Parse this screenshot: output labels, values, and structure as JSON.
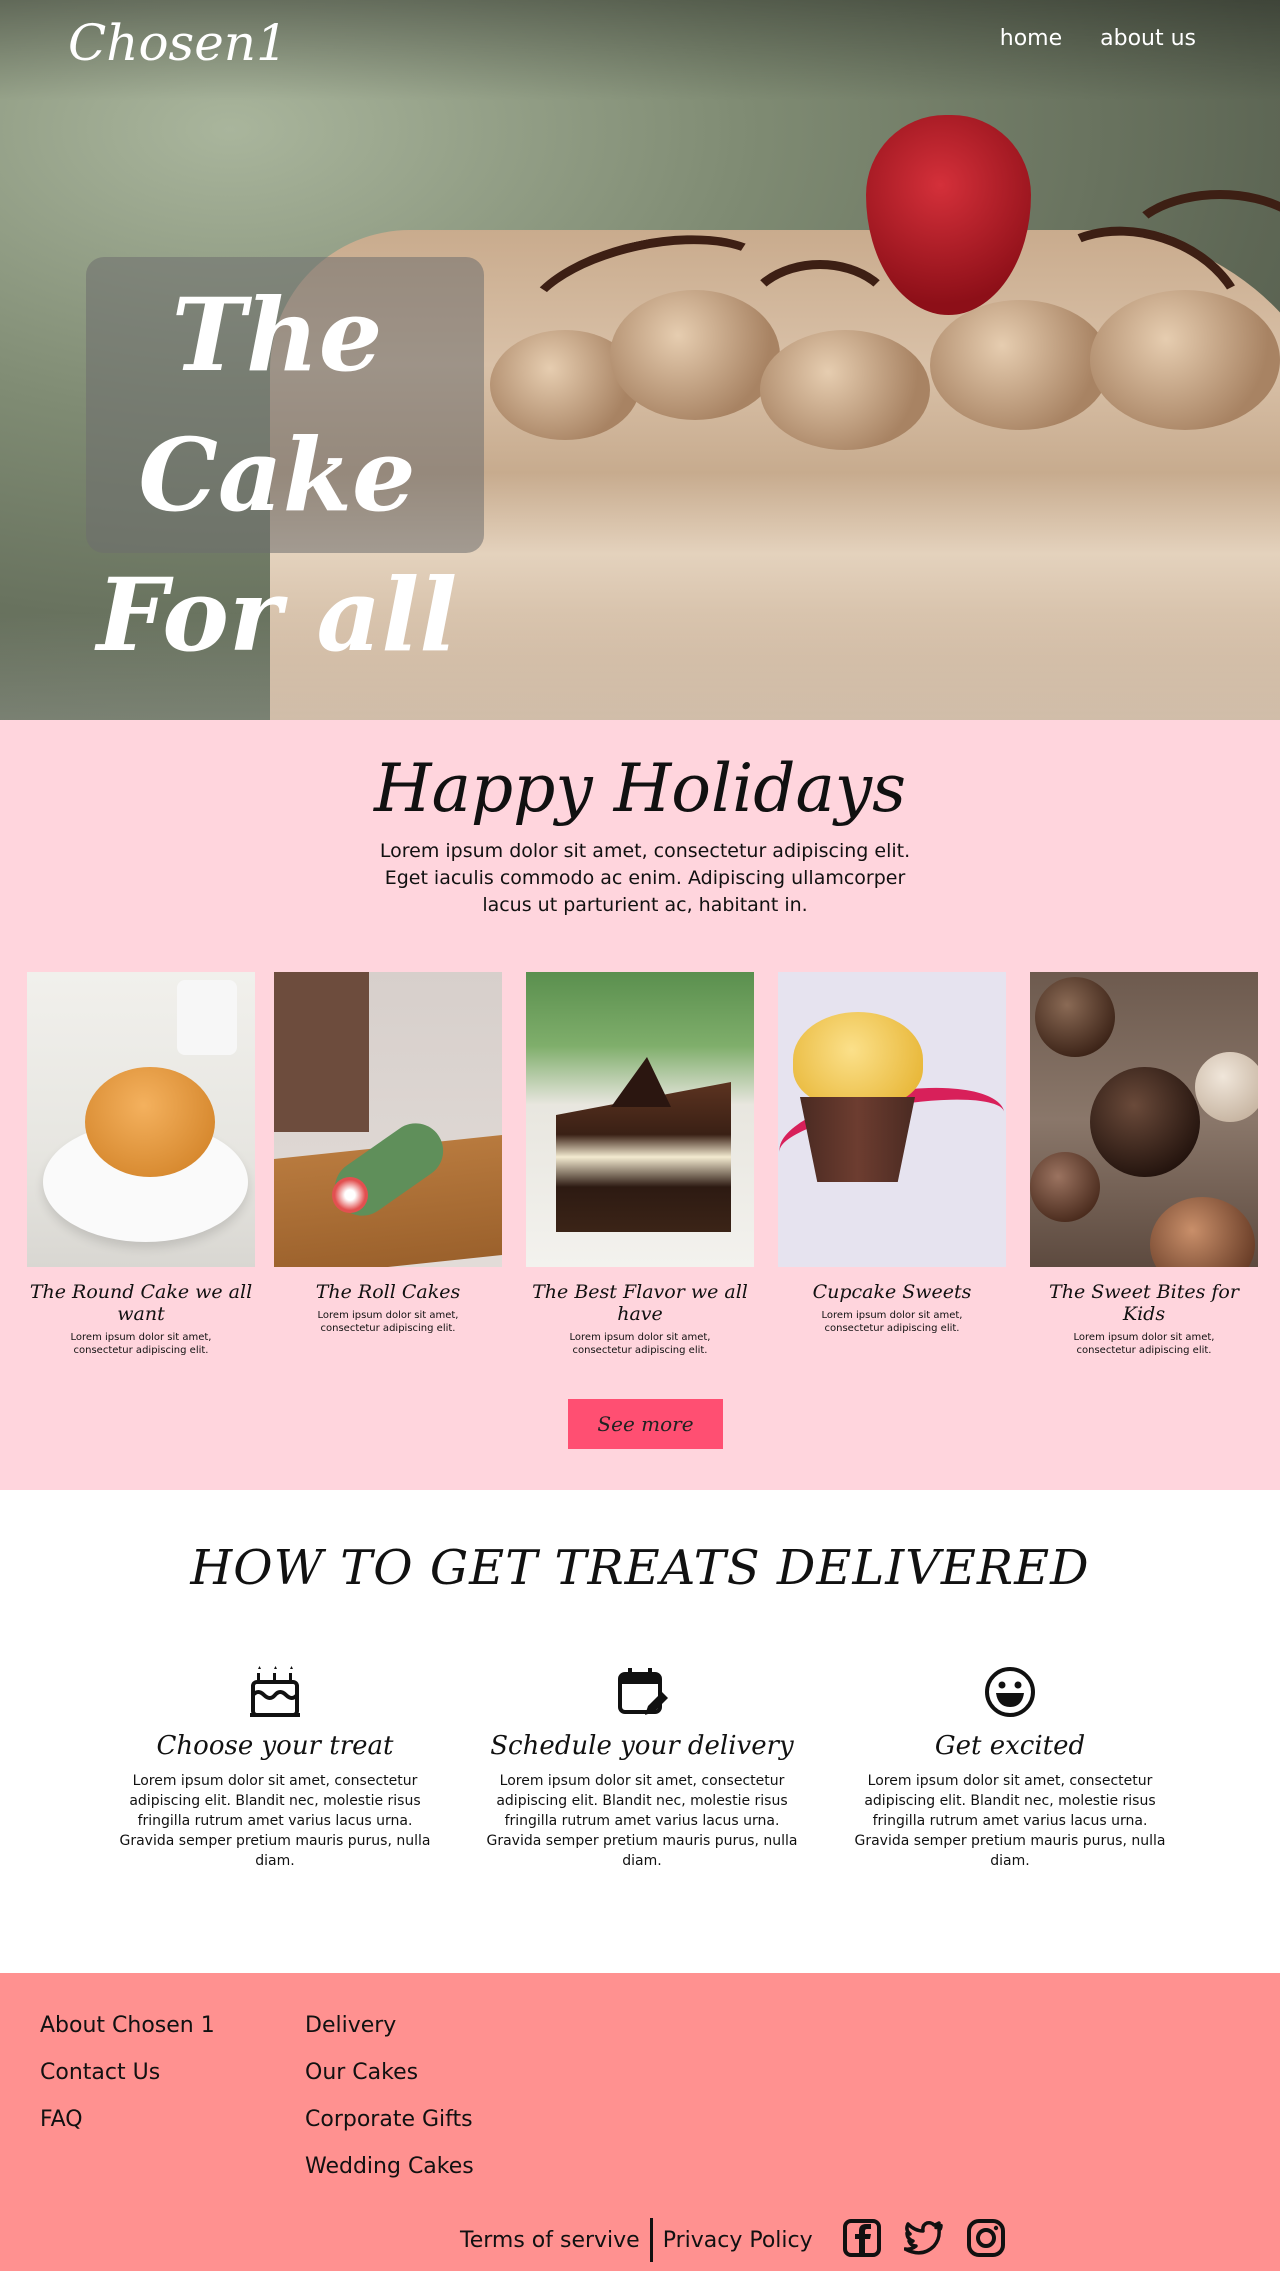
{
  "brand": {
    "logo": "Chosen1"
  },
  "nav": {
    "items": [
      "home",
      "about us"
    ]
  },
  "hero": {
    "title_line1": "The Cake",
    "title_line2": "For all"
  },
  "holidays": {
    "title": "Happy Holidays",
    "intro": "Lorem ipsum dolor sit amet, consectetur adipiscing elit. Eget iaculis commodo ac enim. Adipiscing ullamcorper lacus ut parturient ac, habitant in.",
    "cards": [
      {
        "caption": "The Round Cake we all want",
        "desc": "Lorem ipsum dolor sit amet, consectetur adipiscing elit."
      },
      {
        "caption": "The Roll Cakes",
        "desc": "Lorem ipsum dolor sit amet, consectetur adipiscing elit."
      },
      {
        "caption": "The Best Flavor we all have",
        "desc": "Lorem ipsum dolor sit amet, consectetur adipiscing elit."
      },
      {
        "caption": "Cupcake Sweets",
        "desc": "Lorem ipsum dolor sit amet, consectetur adipiscing elit."
      },
      {
        "caption": "The Sweet Bites for Kids",
        "desc": "Lorem ipsum dolor sit amet, consectetur adipiscing elit."
      }
    ],
    "see_more_label": "See more"
  },
  "delivery": {
    "title": "HOW TO GET TREATS DELIVERED",
    "steps": [
      {
        "title": "Choose your treat",
        "icon": "birthday-cake-icon",
        "desc": "Lorem ipsum dolor sit amet, consectetur adipiscing elit. Blandit nec, molestie risus fringilla rutrum amet varius lacus urna. Gravida semper pretium mauris purus, nulla diam."
      },
      {
        "title": "Schedule your delivery",
        "icon": "calendar-edit-icon",
        "desc": "Lorem ipsum dolor sit amet, consectetur adipiscing elit. Blandit nec, molestie risus fringilla rutrum amet varius lacus urna. Gravida semper pretium mauris purus, nulla diam."
      },
      {
        "title": "Get excited",
        "icon": "smiley-icon",
        "desc": "Lorem ipsum dolor sit amet, consectetur adipiscing elit. Blandit nec, molestie risus fringilla rutrum amet varius lacus urna. Gravida semper pretium mauris purus, nulla diam."
      }
    ]
  },
  "footer": {
    "col1": [
      "About Chosen 1",
      "Contact Us",
      "FAQ"
    ],
    "col2": [
      "Delivery",
      "Our Cakes",
      "Corporate Gifts",
      "Wedding Cakes"
    ],
    "terms": "Terms of servive",
    "privacy": "Privacy Policy",
    "social_icons": [
      "facebook-icon",
      "twitter-icon",
      "instagram-icon"
    ]
  },
  "colors": {
    "pink_bg": "#ffd5dd",
    "button": "#ff4f72",
    "footer": "#ff9190"
  }
}
